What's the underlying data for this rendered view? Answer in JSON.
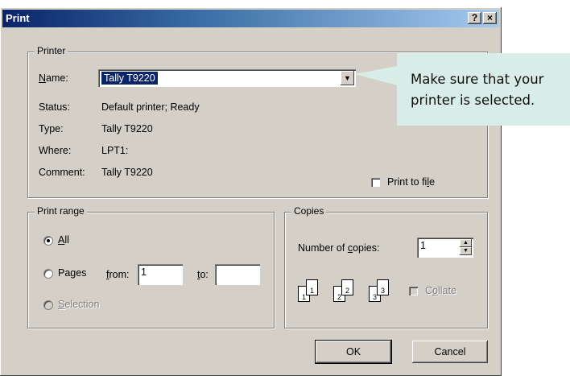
{
  "window": {
    "title": "Print",
    "help_label": "?",
    "close_label": "×"
  },
  "printer": {
    "group_label": "Printer",
    "name_label": "Name:",
    "name_value": "Tally T9220",
    "status_label": "Status:",
    "status_value": "Default printer; Ready",
    "type_label": "Type:",
    "type_value": "Tally T9220",
    "where_label": "Where:",
    "where_value": "LPT1:",
    "comment_label": "Comment:",
    "comment_value": "Tally T9220",
    "print_to_file_label": "Print to file"
  },
  "print_range": {
    "group_label": "Print range",
    "all_label": "All",
    "pages_label": "Pages",
    "from_label": "from:",
    "from_value": "1",
    "to_label": "to:",
    "to_value": "",
    "selection_label": "Selection",
    "selected": "all"
  },
  "copies": {
    "group_label": "Copies",
    "number_label": "Number of copies:",
    "number_value": "1",
    "collate_label": "Collate",
    "page_numbers": [
      "1",
      "1",
      "2",
      "2",
      "3",
      "3"
    ]
  },
  "buttons": {
    "ok_label": "OK",
    "cancel_label": "Cancel"
  },
  "callout": {
    "line1": "Make sure that your",
    "line2": "printer is selected."
  }
}
